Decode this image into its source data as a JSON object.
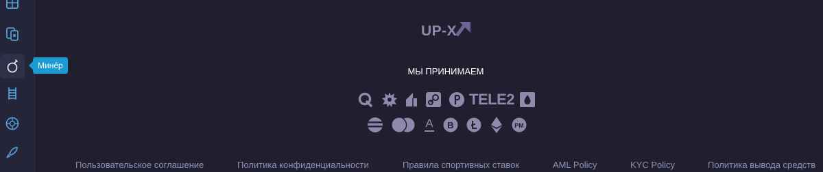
{
  "sidebar": {
    "items": [
      {
        "icon": "dice-grid-icon"
      },
      {
        "icon": "cards-icon"
      },
      {
        "icon": "bomb-icon",
        "label": "Минёр"
      },
      {
        "icon": "ladder-icon"
      },
      {
        "icon": "wheel-icon"
      },
      {
        "icon": "rocket-icon"
      }
    ],
    "tooltip": "Минёр"
  },
  "logo": {
    "text": "UP-X"
  },
  "payments": {
    "title": "МЫ ПРИНИМАЕМ",
    "row1": [
      "qiwi-icon",
      "gear-badge-icon",
      "yoomoney-icon",
      "steam-icon",
      "payeer-icon",
      "tele2-logo",
      "drop-icon"
    ],
    "row2": [
      "striped-ball-icon",
      "mastercard-icon",
      "advcash-icon",
      "bitcoin-icon",
      "litecoin-icon",
      "ethereum-icon",
      "perfect-money-icon"
    ],
    "tele2_text": "TELE2",
    "pm_text": "PM",
    "advcash_text": "A"
  },
  "footer": {
    "links": [
      "Пользовательское соглашение",
      "Политика конфиденциальности",
      "Правила спортивных ставок",
      "AML Policy",
      "KYC Policy",
      "Политика вывода средств"
    ]
  },
  "colors": {
    "background": "#1f1f30",
    "sidebar": "#252539",
    "accent": "#1b9bd1",
    "muted": "#8f8aab"
  }
}
